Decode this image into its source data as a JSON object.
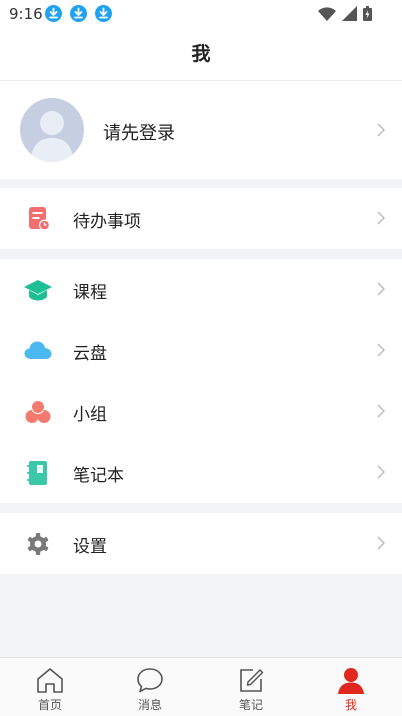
{
  "status_bar": {
    "time": "9:16"
  },
  "header": {
    "title": "我"
  },
  "profile": {
    "login_prompt": "请先登录"
  },
  "menu": {
    "todo": "待办事项",
    "course": "课程",
    "cloud": "云盘",
    "group": "小组",
    "notebook": "笔记本",
    "settings": "设置"
  },
  "tabbar": {
    "home": "首页",
    "messages": "消息",
    "notes": "笔记",
    "me": "我"
  },
  "colors": {
    "accent_red": "#e0281e",
    "todo_icon": "#f36e6e",
    "course_icon": "#1ebf95",
    "cloud_icon": "#4bb8f0",
    "group_icon": "#f47a6e",
    "notebook_icon": "#3cc7a8",
    "settings_icon": "#7a7a7a"
  }
}
